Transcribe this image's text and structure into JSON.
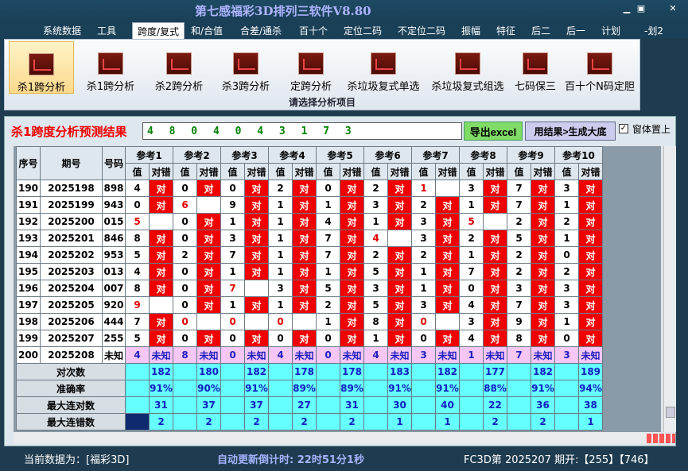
{
  "window": {
    "title": "第七感福彩3D排列三软件V8.80"
  },
  "menu": [
    "系统数据",
    "工具",
    "跨度/复式",
    "和/合值",
    "合差/通杀",
    "百十个",
    "定位二码",
    "不定位二码",
    "振幅",
    "特征",
    "后二",
    "后一",
    "计划",
    "-划2"
  ],
  "ribbon": {
    "buttons": [
      "杀1跨分析",
      "杀1跨分析",
      "杀2跨分析",
      "杀3跨分析",
      "定跨分析",
      "杀垃圾复式单选",
      "杀垃圾复式组选",
      "七码保三",
      "百十个N码定胆"
    ],
    "caption": "请选择分析项目"
  },
  "panel": {
    "title": "杀1跨度分析预测结果",
    "result": "4 8 0 4 0 4 3 1 7 3",
    "export_label": "导出excel",
    "generate_label": "用结果>生成大底",
    "ontop_label": "窗体置上",
    "ontop_checked": true
  },
  "table": {
    "headers": {
      "seq": "序号",
      "period": "期号",
      "number": "号码",
      "refs": [
        "参考1",
        "参考2",
        "参考3",
        "参考4",
        "参考5",
        "参考6",
        "参考7",
        "参考8",
        "参考9",
        "参考10"
      ],
      "val": "值",
      "mark": "对错"
    },
    "rows": [
      {
        "seq": "190",
        "period": "2025198",
        "number": "898",
        "vals": [
          "4",
          "0",
          "0",
          "2",
          "0",
          "2",
          "1",
          "3",
          "7",
          "3"
        ],
        "marks": [
          "对",
          "对",
          "对",
          "对",
          "对",
          "对",
          "",
          "对",
          "对",
          "对"
        ]
      },
      {
        "seq": "191",
        "period": "2025199",
        "number": "943",
        "vals": [
          "0",
          "6",
          "9",
          "1",
          "1",
          "3",
          "2",
          "1",
          "7",
          "1"
        ],
        "marks": [
          "对",
          "",
          "对",
          "对",
          "对",
          "对",
          "对",
          "对",
          "对",
          "对"
        ]
      },
      {
        "seq": "192",
        "period": "2025200",
        "number": "015",
        "vals": [
          "5",
          "0",
          "1",
          "1",
          "4",
          "1",
          "3",
          "5",
          "2",
          "2"
        ],
        "marks": [
          "",
          "对",
          "对",
          "对",
          "对",
          "对",
          "对",
          "",
          "对",
          "对"
        ]
      },
      {
        "seq": "193",
        "period": "2025201",
        "number": "846",
        "vals": [
          "8",
          "0",
          "3",
          "1",
          "7",
          "4",
          "3",
          "2",
          "5",
          "1"
        ],
        "marks": [
          "对",
          "对",
          "对",
          "对",
          "对",
          "",
          "对",
          "对",
          "对",
          "对"
        ]
      },
      {
        "seq": "194",
        "period": "2025202",
        "number": "953",
        "vals": [
          "5",
          "2",
          "7",
          "1",
          "7",
          "2",
          "2",
          "1",
          "2",
          "0"
        ],
        "marks": [
          "对",
          "对",
          "对",
          "对",
          "对",
          "对",
          "对",
          "对",
          "对",
          "对"
        ]
      },
      {
        "seq": "195",
        "period": "2025203",
        "number": "013",
        "vals": [
          "4",
          "0",
          "1",
          "1",
          "1",
          "5",
          "1",
          "7",
          "2",
          "2"
        ],
        "marks": [
          "对",
          "对",
          "对",
          "对",
          "对",
          "对",
          "对",
          "对",
          "对",
          "对"
        ]
      },
      {
        "seq": "196",
        "period": "2025204",
        "number": "007",
        "vals": [
          "8",
          "0",
          "7",
          "3",
          "5",
          "3",
          "1",
          "0",
          "3",
          "3"
        ],
        "marks": [
          "对",
          "对",
          "",
          "对",
          "对",
          "对",
          "对",
          "对",
          "对",
          "对"
        ]
      },
      {
        "seq": "197",
        "period": "2025205",
        "number": "920",
        "vals": [
          "9",
          "0",
          "1",
          "1",
          "2",
          "5",
          "3",
          "4",
          "7",
          "3"
        ],
        "marks": [
          "",
          "对",
          "对",
          "对",
          "对",
          "对",
          "对",
          "对",
          "对",
          "对"
        ]
      },
      {
        "seq": "198",
        "period": "2025206",
        "number": "444",
        "vals": [
          "7",
          "0",
          "0",
          "0",
          "1",
          "8",
          "0",
          "3",
          "9",
          "1"
        ],
        "marks": [
          "对",
          "",
          "",
          "",
          "对",
          "对",
          "",
          "对",
          "对",
          "对"
        ]
      },
      {
        "seq": "199",
        "period": "2025207",
        "number": "255",
        "vals": [
          "5",
          "0",
          "0",
          "0",
          "0",
          "1",
          "0",
          "4",
          "8",
          "0"
        ],
        "marks": [
          "对",
          "对",
          "对",
          "对",
          "对",
          "对",
          "对",
          "对",
          "对",
          "对"
        ]
      }
    ],
    "forecast": {
      "seq": "200",
      "period": "2025208",
      "number": "未知",
      "vals": [
        "4",
        "8",
        "0",
        "4",
        "0",
        "4",
        "3",
        "1",
        "7",
        "3"
      ],
      "mark": "未知"
    },
    "stats": [
      {
        "label": "对次数",
        "values": [
          "182",
          "180",
          "182",
          "178",
          "178",
          "183",
          "182",
          "177",
          "182",
          "189"
        ]
      },
      {
        "label": "准确率",
        "values": [
          "91%",
          "90%",
          "91%",
          "89%",
          "89%",
          "91%",
          "91%",
          "88%",
          "91%",
          "94%"
        ]
      },
      {
        "label": "最大连对数",
        "values": [
          "31",
          "37",
          "37",
          "27",
          "31",
          "30",
          "40",
          "22",
          "36",
          "38"
        ]
      },
      {
        "label": "最大连错数",
        "values": [
          "2",
          "2",
          "2",
          "2",
          "2",
          "1",
          "1",
          "2",
          "2",
          "1"
        ]
      }
    ]
  },
  "status": {
    "current": "当前数据为：[福彩3D]",
    "countdown": "自动更新倒计时:  22时51分1秒",
    "draw": "FC3D第 2025207 期开:【255】【746】"
  }
}
